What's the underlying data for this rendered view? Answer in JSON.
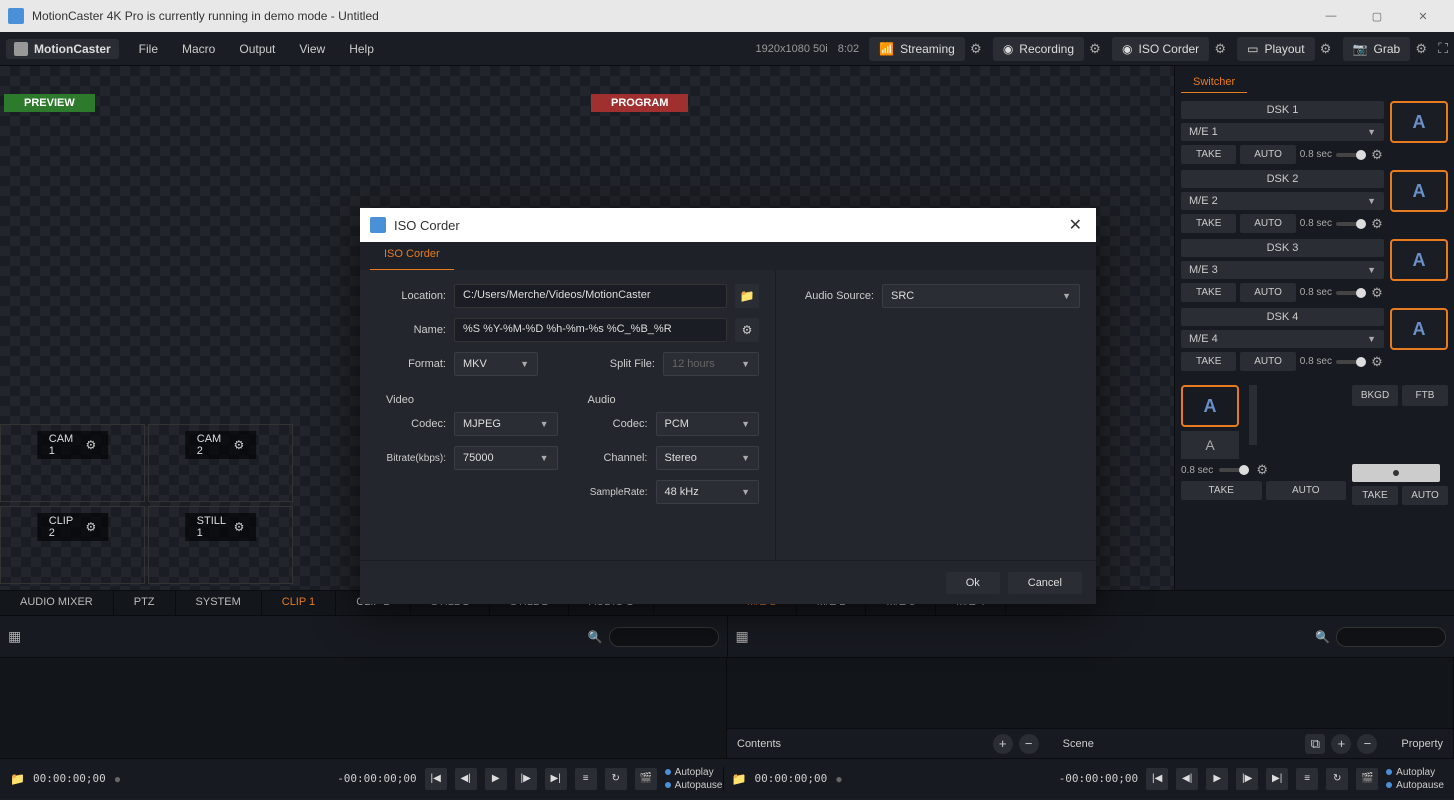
{
  "titlebar": {
    "title": "MotionCaster 4K Pro is currently running in demo mode - Untitled"
  },
  "app": {
    "name": "MotionCaster"
  },
  "menu": {
    "items": [
      "File",
      "Macro",
      "Output",
      "View",
      "Help"
    ]
  },
  "status": {
    "resolution": "1920x1080 50i",
    "time": "8:02"
  },
  "actions": {
    "streaming": "Streaming",
    "recording": "Recording",
    "iso": "ISO Corder",
    "playout": "Playout",
    "grab": "Grab"
  },
  "preview": {
    "label": "PREVIEW"
  },
  "program": {
    "label": "PROGRAM"
  },
  "sources": {
    "row1": [
      {
        "label": "CAM 1"
      },
      {
        "label": "CAM 2"
      }
    ],
    "row2": [
      {
        "label": "CLIP 2"
      },
      {
        "label": "STILL 1"
      }
    ]
  },
  "switcher": {
    "tab": "Switcher",
    "dsk": [
      {
        "title": "DSK 1",
        "me": "M/E 1",
        "take": "TAKE",
        "auto": "AUTO",
        "sec": "0.8 sec",
        "a": "A"
      },
      {
        "title": "DSK 2",
        "me": "M/E 2",
        "take": "TAKE",
        "auto": "AUTO",
        "sec": "0.8 sec",
        "a": "A"
      },
      {
        "title": "DSK 3",
        "me": "M/E 3",
        "take": "TAKE",
        "auto": "AUTO",
        "sec": "0.8 sec",
        "a": "A"
      },
      {
        "title": "DSK 4",
        "me": "M/E 4",
        "take": "TAKE",
        "auto": "AUTO",
        "sec": "0.8 sec",
        "a": "A"
      }
    ],
    "bkgd": {
      "a": "A",
      "a2": "A",
      "sec": "0.8 sec",
      "take": "TAKE",
      "auto": "AUTO",
      "bkgd": "BKGD",
      "ftb": "FTB"
    }
  },
  "tabs": {
    "left": [
      "AUDIO MIXER",
      "PTZ",
      "SYSTEM",
      "CLIP 1",
      "CLIP 2",
      "STILL 1",
      "STILL 2",
      "AUDIO 1"
    ],
    "left_active": 3,
    "right": [
      "M/E 1",
      "M/E 2",
      "M/E 3",
      "M/E 4"
    ],
    "right_active": 0
  },
  "contentBar": {
    "contents": "Contents",
    "scene": "Scene",
    "property": "Property"
  },
  "playback": {
    "t1": "00:00:00;00",
    "t2": "-00:00:00;00",
    "autoplay": "Autoplay",
    "autopause": "Autopause"
  },
  "modal": {
    "title": "ISO Corder",
    "tab": "ISO Corder",
    "location_label": "Location:",
    "location": "C:/Users/Merche/Videos/MotionCaster",
    "name_label": "Name:",
    "name": "%S %Y-%M-%D %h-%m-%s %C_%B_%R",
    "format_label": "Format:",
    "format": "MKV",
    "split_label": "Split File:",
    "split": "12 hours",
    "video": "Video",
    "audio": "Audio",
    "vcodec_label": "Codec:",
    "vcodec": "MJPEG",
    "bitrate_label": "Bitrate(kbps):",
    "bitrate": "75000",
    "acodec_label": "Codec:",
    "acodec": "PCM",
    "channel_label": "Channel:",
    "channel": "Stereo",
    "sample_label": "SampleRate:",
    "sample": "48 kHz",
    "audiosrc_label": "Audio Source:",
    "audiosrc": "SRC",
    "ok": "Ok",
    "cancel": "Cancel"
  }
}
